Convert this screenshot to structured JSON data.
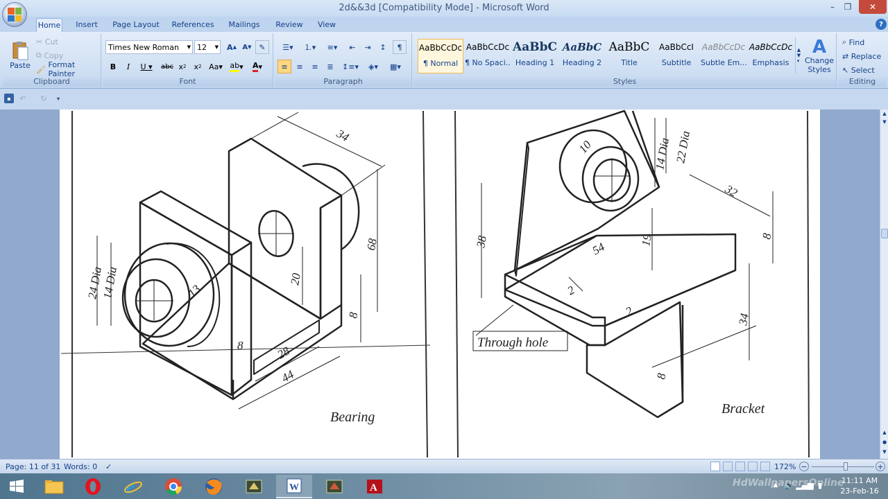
{
  "window": {
    "title": "2d&&3d [Compatibility Mode] - Microsoft Word",
    "minimize": "–",
    "restore": "❐",
    "close": "✕"
  },
  "tabs": [
    {
      "label": "Home"
    },
    {
      "label": "Insert"
    },
    {
      "label": "Page Layout"
    },
    {
      "label": "References"
    },
    {
      "label": "Mailings"
    },
    {
      "label": "Review"
    },
    {
      "label": "View"
    }
  ],
  "clipboard": {
    "paste": "Paste",
    "cut": "Cut",
    "copy": "Copy",
    "format_painter": "Format Painter",
    "group": "Clipboard"
  },
  "font": {
    "name": "Times New Roman",
    "size": "12",
    "group": "Font"
  },
  "paragraph": {
    "group": "Paragraph"
  },
  "styles": {
    "group": "Styles",
    "items": [
      {
        "preview": "AaBbCcDc",
        "name": "¶ Normal"
      },
      {
        "preview": "AaBbCcDc",
        "name": "¶ No Spaci..."
      },
      {
        "preview": "AaBbC",
        "name": "Heading 1"
      },
      {
        "preview": "AaBbC",
        "name": "Heading 2"
      },
      {
        "preview": "AaBbC",
        "name": "Title"
      },
      {
        "preview": "AaBbCcI",
        "name": "Subtitle"
      },
      {
        "preview": "AaBbCcDc",
        "name": "Subtle Em..."
      },
      {
        "preview": "AaBbCcDc",
        "name": "Emphasis"
      }
    ],
    "change_styles": "Change Styles"
  },
  "editing": {
    "find": "Find",
    "replace": "Replace",
    "select": "Select",
    "group": "Editing"
  },
  "drawing": {
    "bearing": {
      "caption": "Bearing",
      "dims": [
        "34",
        "68",
        "24 Dia",
        "14 Dia",
        "13",
        "20",
        "8",
        "8",
        "28",
        "44"
      ]
    },
    "bracket": {
      "caption": "Bracket",
      "note": "Through hole",
      "dims": [
        "10",
        "14 Dia",
        "22 Dia",
        "32",
        "8",
        "38",
        "54",
        "19",
        "2",
        "2",
        "34",
        "8"
      ]
    }
  },
  "status": {
    "page": "Page: 11 of 31",
    "words": "Words: 0",
    "zoom": "172%"
  },
  "clock": {
    "time": "11:11 AM",
    "date": "23-Feb-16"
  },
  "watermark": "HdWallpapersOnline"
}
